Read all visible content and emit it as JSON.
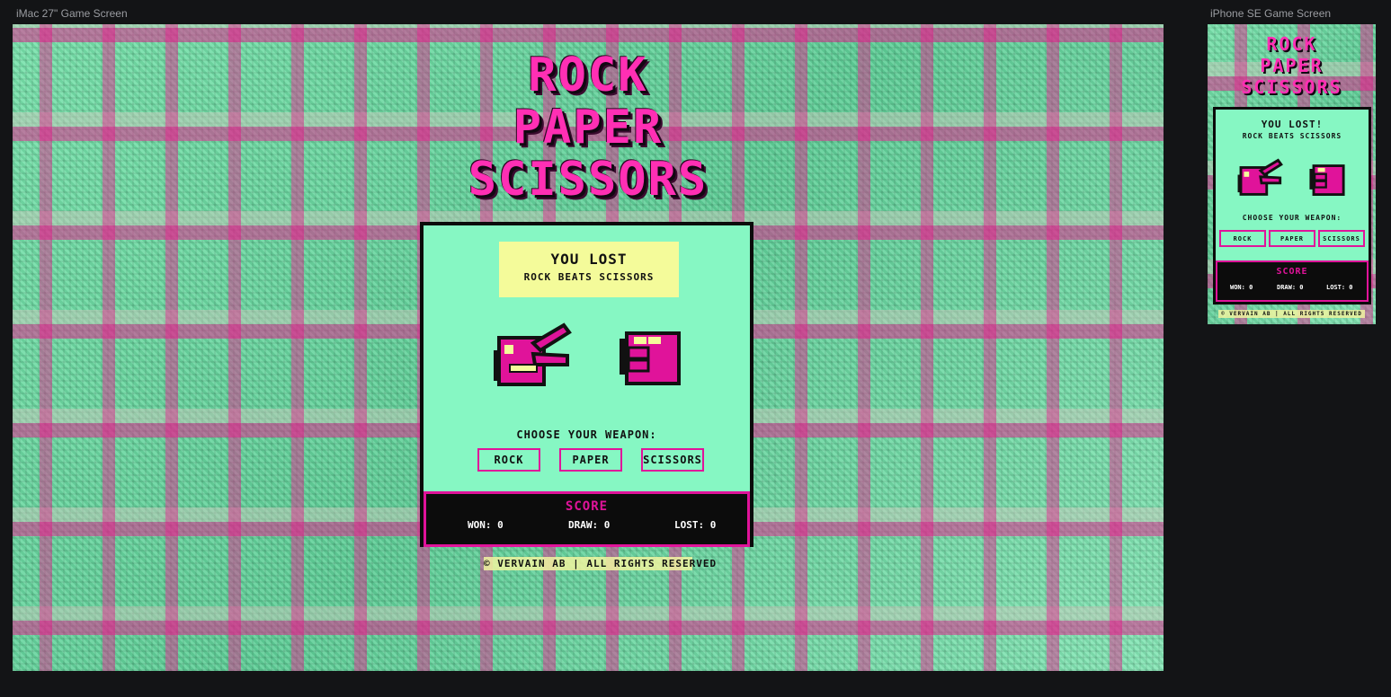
{
  "frames": {
    "desktop_label": "iMac 27\" Game Screen",
    "mobile_label": "iPhone SE Game Screen"
  },
  "game": {
    "title_lines": [
      "ROCK",
      "PAPER",
      "SCISSORS"
    ],
    "result_title_desktop": "YOU LOST",
    "result_title_mobile": "YOU LOST!",
    "result_sub": "ROCK BEATS SCISSORS",
    "player_hand_icon": "scissors-hand-icon",
    "computer_hand_icon": "rock-fist-icon",
    "choose_label": "CHOOSE YOUR WEAPON:",
    "buttons": {
      "rock": "ROCK",
      "paper": "PAPER",
      "scissors": "SCISSORS"
    },
    "score": {
      "title": "SCORE",
      "won": "WON: 0",
      "draw": "DRAW: 0",
      "lost": "LOST: 0"
    },
    "footer": "© VERVAIN AB | ALL RIGHTS RESERVED"
  },
  "colors": {
    "accent_pink": "#e0139a",
    "panel_mint": "#86f7c3",
    "result_yellow": "#f4fb9a",
    "score_bg": "#0c0c0c",
    "app_bg": "#131416"
  }
}
